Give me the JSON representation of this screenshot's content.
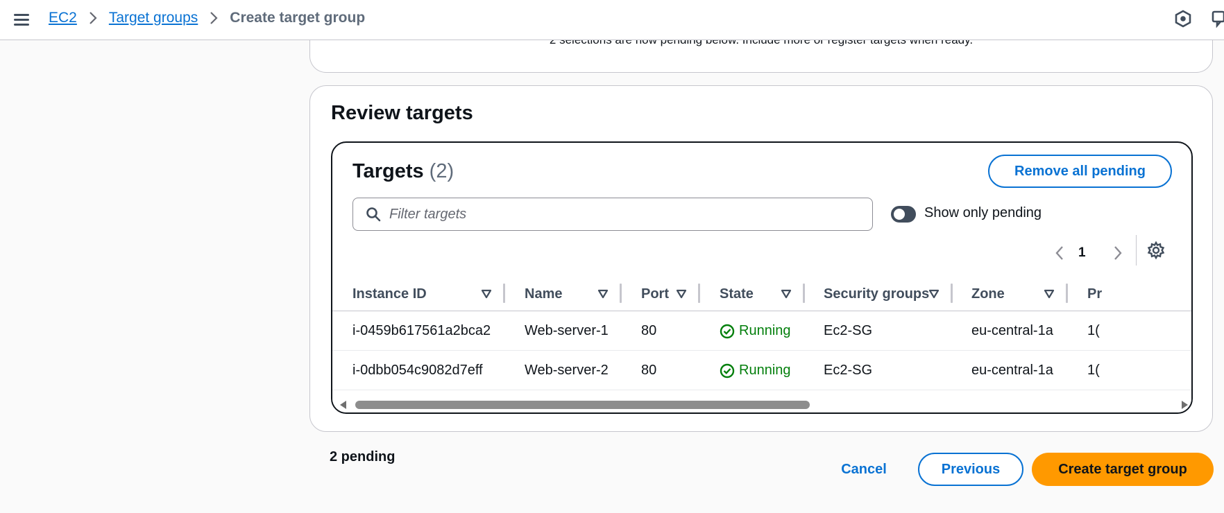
{
  "breadcrumb": {
    "items": [
      "EC2",
      "Target groups"
    ],
    "current": "Create target group"
  },
  "pending_panel": {
    "message": "2 selections are now pending below. Include more or register targets when ready."
  },
  "review": {
    "title": "Review targets",
    "targets_title": "Targets",
    "targets_count": "(2)",
    "remove_all_label": "Remove all pending",
    "filter_placeholder": "Filter targets",
    "toggle_label": "Show only pending",
    "page_number": "1",
    "columns": [
      "Instance ID",
      "Name",
      "Port",
      "State",
      "Security groups",
      "Zone",
      "Pr"
    ],
    "rows": [
      {
        "instance_id": "i-0459b617561a2bca2",
        "name": "Web-server-1",
        "port": "80",
        "state": "Running",
        "security_groups": "Ec2-SG",
        "zone": "eu-central-1a",
        "extra": "1("
      },
      {
        "instance_id": "i-0dbb054c9082d7eff",
        "name": "Web-server-2",
        "port": "80",
        "state": "Running",
        "security_groups": "Ec2-SG",
        "zone": "eu-central-1a",
        "extra": "1("
      }
    ]
  },
  "footer": {
    "pending_text": "2 pending",
    "cancel_label": "Cancel",
    "previous_label": "Previous",
    "create_label": "Create target group"
  },
  "colors": {
    "link": "#0972d3",
    "primary_button": "#ff9900",
    "success": "#037f0c"
  }
}
